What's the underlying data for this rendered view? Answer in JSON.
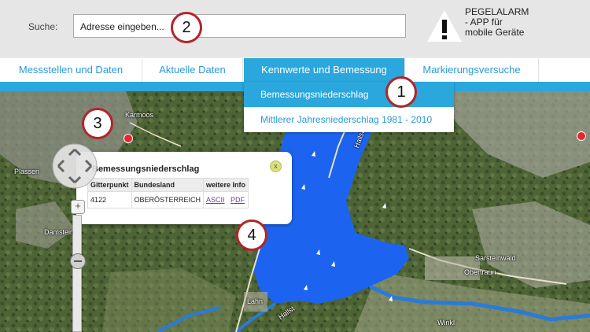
{
  "header": {
    "search_label": "Suche:",
    "search_value": "Adresse eingeben...",
    "alarm_text_line1": "PEGELALARM",
    "alarm_text_line2": "- APP für",
    "alarm_text_line3": "mobile Geräte"
  },
  "nav": {
    "tabs": [
      {
        "label": "Messstellen und Daten"
      },
      {
        "label": "Aktuelle Daten"
      },
      {
        "label": "Kennwerte und Bemessung"
      },
      {
        "label": "Markierungsversuche"
      }
    ],
    "active_tab": "Kennwerte und Bemessung"
  },
  "dropdown": {
    "items": [
      {
        "label": "Bemessungsniederschlag"
      },
      {
        "label": "Mittlerer Jahresniederschlag 1981 - 2010"
      }
    ],
    "selected": "Bemessungsniederschlag"
  },
  "map": {
    "labels": {
      "karmoos": "Karmoos",
      "plassen": "Plassen",
      "damstein": "Damstein",
      "hallstaetter": "Hallstätter",
      "sarsteinwald": "Sarsteinwald",
      "obertraun": "Obertraun",
      "lahn": "Lahn",
      "winkl": "Winkl",
      "hallst": "Hallst"
    }
  },
  "popup": {
    "title": "Bemessungsniederschlag",
    "close": "x",
    "columns": [
      "Gitterpunkt",
      "Bundesland",
      "weitere Info"
    ],
    "row": {
      "gitterpunkt": "4122",
      "bundesland": "OBERÖSTERREICH",
      "ascii": "ASCII",
      "pdf": "PDF"
    }
  },
  "zoom": {
    "plus": "+"
  },
  "badges": [
    "1",
    "2",
    "3",
    "4"
  ],
  "colors": {
    "accent": "#2aa7dc",
    "lake": "#1c64f0",
    "badge_border": "#b3242a",
    "marker": "#e8262b"
  }
}
